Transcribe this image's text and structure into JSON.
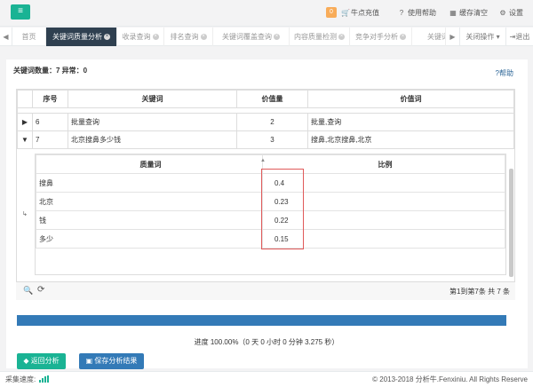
{
  "header": {
    "badge": "0",
    "recharge": "牛点充值",
    "help": "使用帮助",
    "clear_cache": "缓存清空",
    "settings": "设置"
  },
  "tabs": {
    "prev": "◀",
    "home": "首页",
    "items": [
      "关键词质量分析",
      "收录查询",
      "排名查询",
      "关键词覆盖查询",
      "内容质量检测",
      "竞争对手分析",
      "关键词"
    ],
    "next": "▶",
    "close_ops": "关闭操作",
    "logout": "退出"
  },
  "stats": "关键词数量：7   异常：0",
  "help_link": "帮助",
  "table": {
    "headers": [
      "序号",
      "关键词",
      "价值量",
      "价值词"
    ],
    "rows": [
      {
        "id": "6",
        "keyword": "批量查询",
        "value": "2",
        "words": "批量,查询"
      },
      {
        "id": "7",
        "keyword": "北京搜鼻多少钱",
        "value": "3",
        "words": "搜鼻,北京搜鼻,北京"
      }
    ]
  },
  "nested": {
    "headers": [
      "质量词",
      "比例"
    ],
    "rows": [
      {
        "word": "搜鼻",
        "ratio": "0.4"
      },
      {
        "word": "北京",
        "ratio": "0.23"
      },
      {
        "word": "钱",
        "ratio": "0.22"
      },
      {
        "word": "多少",
        "ratio": "0.15"
      }
    ]
  },
  "pager": {
    "text": "第1到第7条 共 7 条"
  },
  "progress": {
    "percent": 100,
    "text": "进度 100.00%（0 天 0 小时 0 分钟 3.275 秒）"
  },
  "buttons": {
    "back": "返回分析",
    "save": "保存分析结果"
  },
  "footer": {
    "speed_label": "采集速度:",
    "copyright": "© 2013-2018 分析牛.Fenxiniu. All Rights Reserve"
  },
  "colors": {
    "accent": "#1ab394",
    "primary": "#337ab7",
    "dark": "#2f4050",
    "badge": "#f8ac59",
    "highlight": "#e05a5a"
  }
}
